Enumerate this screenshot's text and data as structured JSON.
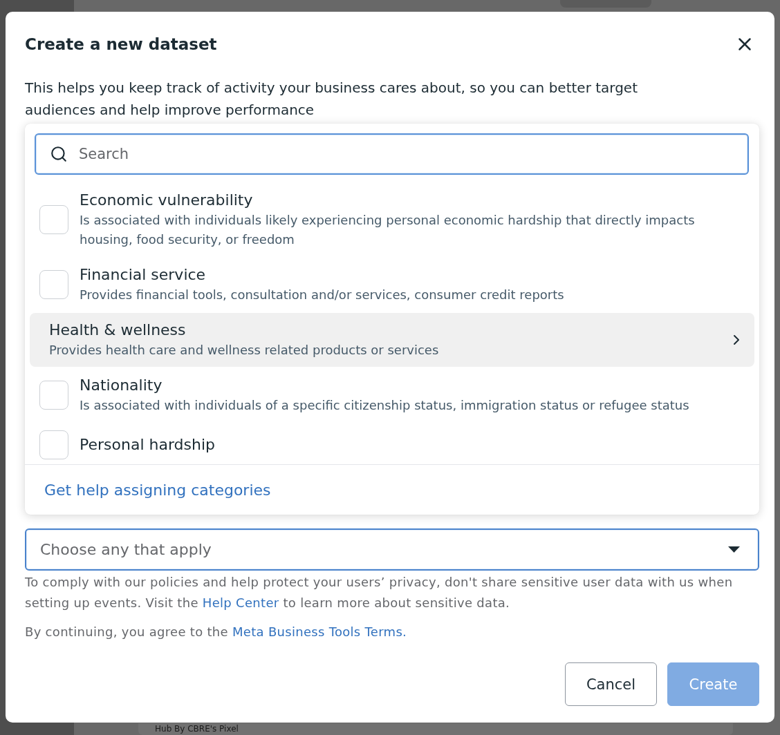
{
  "dialog": {
    "title": "Create a new dataset",
    "description": "This helps you keep track of activity your business cares about, so you can better target audiences and help improve performance",
    "category_menu": {
      "search": {
        "placeholder": "Search"
      },
      "options": [
        {
          "kind": "checkbox",
          "title": "Economic vulnerability",
          "description": "Is associated with individuals likely experiencing personal economic hardship that directly impacts housing, food security, or freedom",
          "checked": false,
          "highlighted": false
        },
        {
          "kind": "checkbox",
          "title": "Financial service",
          "description": "Provides financial tools, consultation and/or services, consumer credit reports",
          "checked": false,
          "highlighted": false
        },
        {
          "kind": "submenu",
          "title": "Health & wellness",
          "description": "Provides health care and wellness related products or services",
          "highlighted": true
        },
        {
          "kind": "checkbox",
          "title": "Nationality",
          "description": "Is associated with individuals of a specific citizenship status, immigration status or refugee status",
          "checked": false,
          "highlighted": false
        },
        {
          "kind": "checkbox",
          "title": "Personal hardship",
          "checked": false,
          "highlighted": false
        }
      ],
      "footer_link": "Get help assigning categories"
    },
    "category_select": {
      "placeholder": "Choose any that apply"
    },
    "privacy_note": {
      "before": "To comply with our policies and help protect your users’ privacy, don't share sensitive user data with us when setting up events. Visit the ",
      "link": "Help Center",
      "after": " to learn more about sensitive data."
    },
    "terms": {
      "before": "By continuing, you agree to the ",
      "link": "Meta Business Tools Terms."
    },
    "buttons": [
      {
        "label": "Cancel",
        "kind": "secondary",
        "disabled": false
      },
      {
        "label": "Create",
        "kind": "primary",
        "disabled": true
      }
    ]
  },
  "background": {
    "field_value": "Hub By CBRE's Pixel"
  }
}
